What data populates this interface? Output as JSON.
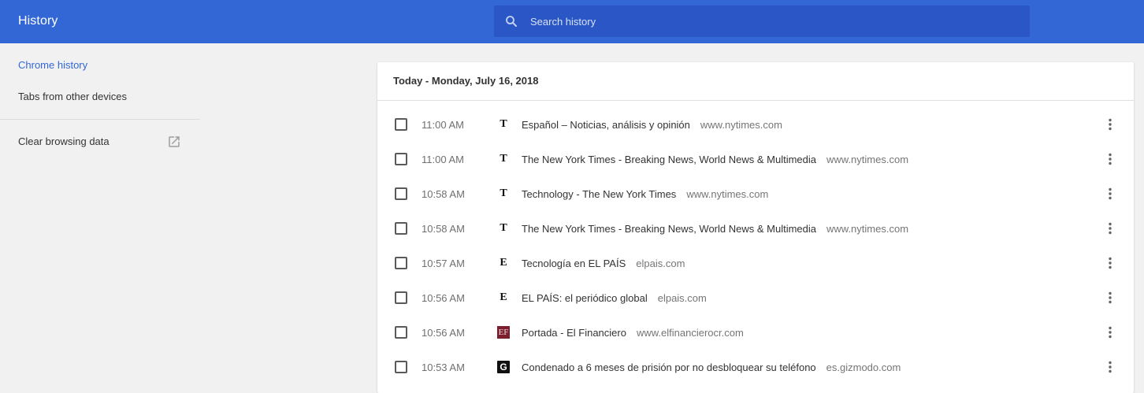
{
  "toolbar": {
    "title": "History",
    "search_placeholder": "Search history"
  },
  "sidebar": {
    "items": [
      {
        "label": "Chrome history"
      },
      {
        "label": "Tabs from other devices"
      },
      {
        "label": "Clear browsing data"
      }
    ]
  },
  "main": {
    "day_header": "Today - Monday, July 16, 2018",
    "entries": [
      {
        "time": "11:00 AM",
        "favicon": "T",
        "title": "Español – Noticias, análisis y opinión",
        "domain": "www.nytimes.com"
      },
      {
        "time": "11:00 AM",
        "favicon": "T",
        "title": "The New York Times - Breaking News, World News & Multimedia",
        "domain": "www.nytimes.com"
      },
      {
        "time": "10:58 AM",
        "favicon": "T",
        "title": "Technology - The New York Times",
        "domain": "www.nytimes.com"
      },
      {
        "time": "10:58 AM",
        "favicon": "T",
        "title": "The New York Times - Breaking News, World News & Multimedia",
        "domain": "www.nytimes.com"
      },
      {
        "time": "10:57 AM",
        "favicon": "E",
        "title": "Tecnología en EL PAÍS",
        "domain": "elpais.com"
      },
      {
        "time": "10:56 AM",
        "favicon": "E",
        "title": "EL PAÍS: el periódico global",
        "domain": "elpais.com"
      },
      {
        "time": "10:56 AM",
        "favicon": "EF",
        "title": "Portada - El Financiero",
        "domain": "www.elfinancierocr.com"
      },
      {
        "time": "10:53 AM",
        "favicon": "G",
        "title": "Condenado a 6 meses de prisión por no desbloquear su teléfono",
        "domain": "es.gizmodo.com"
      }
    ]
  },
  "colors": {
    "toolbar": "#3367d6",
    "search_box": "#2a56c6",
    "selected_nav": "#3367d6"
  }
}
